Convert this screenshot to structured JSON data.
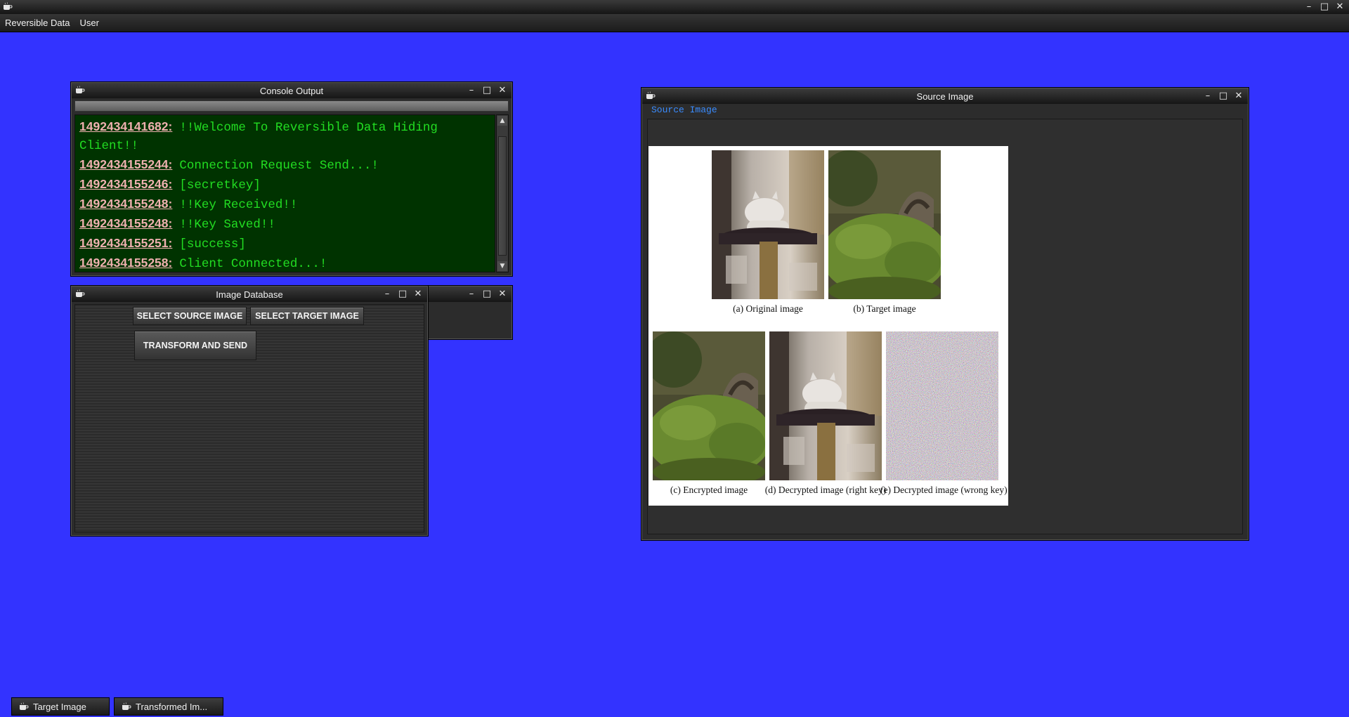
{
  "menu": [
    "Reversible Data",
    "User"
  ],
  "window_controls": {
    "minimize": "–",
    "maximize": "□",
    "close": "✕"
  },
  "console": {
    "title": "Console Output",
    "lines": [
      {
        "ts": "1492434141682:",
        "msg": "!!Welcome To Reversible Data Hiding"
      },
      {
        "ts": "",
        "msg": "Client!!"
      },
      {
        "ts": "1492434155244:",
        "msg": "Connection Request Send...!"
      },
      {
        "ts": "1492434155246:",
        "msg": "[secretkey]"
      },
      {
        "ts": "1492434155248:",
        "msg": "!!Key Received!!"
      },
      {
        "ts": "1492434155248:",
        "msg": "!!Key Saved!!"
      },
      {
        "ts": "1492434155251:",
        "msg": "[success]"
      },
      {
        "ts": "1492434155258:",
        "msg": "Client Connected...!"
      }
    ]
  },
  "image_db": {
    "title": "Image Database",
    "select_source": "SELECT SOURCE IMAGE",
    "select_target": "SELECT TARGET IMAGE",
    "transform": "TRANSFORM AND SEND"
  },
  "source_image": {
    "title": "Source Image",
    "label": "Source Image",
    "captions": {
      "a": "(a) Original image",
      "b": "(b) Target image",
      "c": "(c) Encrypted image",
      "d": "(d) Decrypted image (right key)",
      "e": "(e) Decrypted image (wrong key)"
    }
  },
  "taskbar": [
    "Target Image",
    "Transformed Im..."
  ],
  "colors": {
    "desktop": "#3333ff",
    "console_bg": "#003300",
    "console_text": "#22dd22"
  }
}
